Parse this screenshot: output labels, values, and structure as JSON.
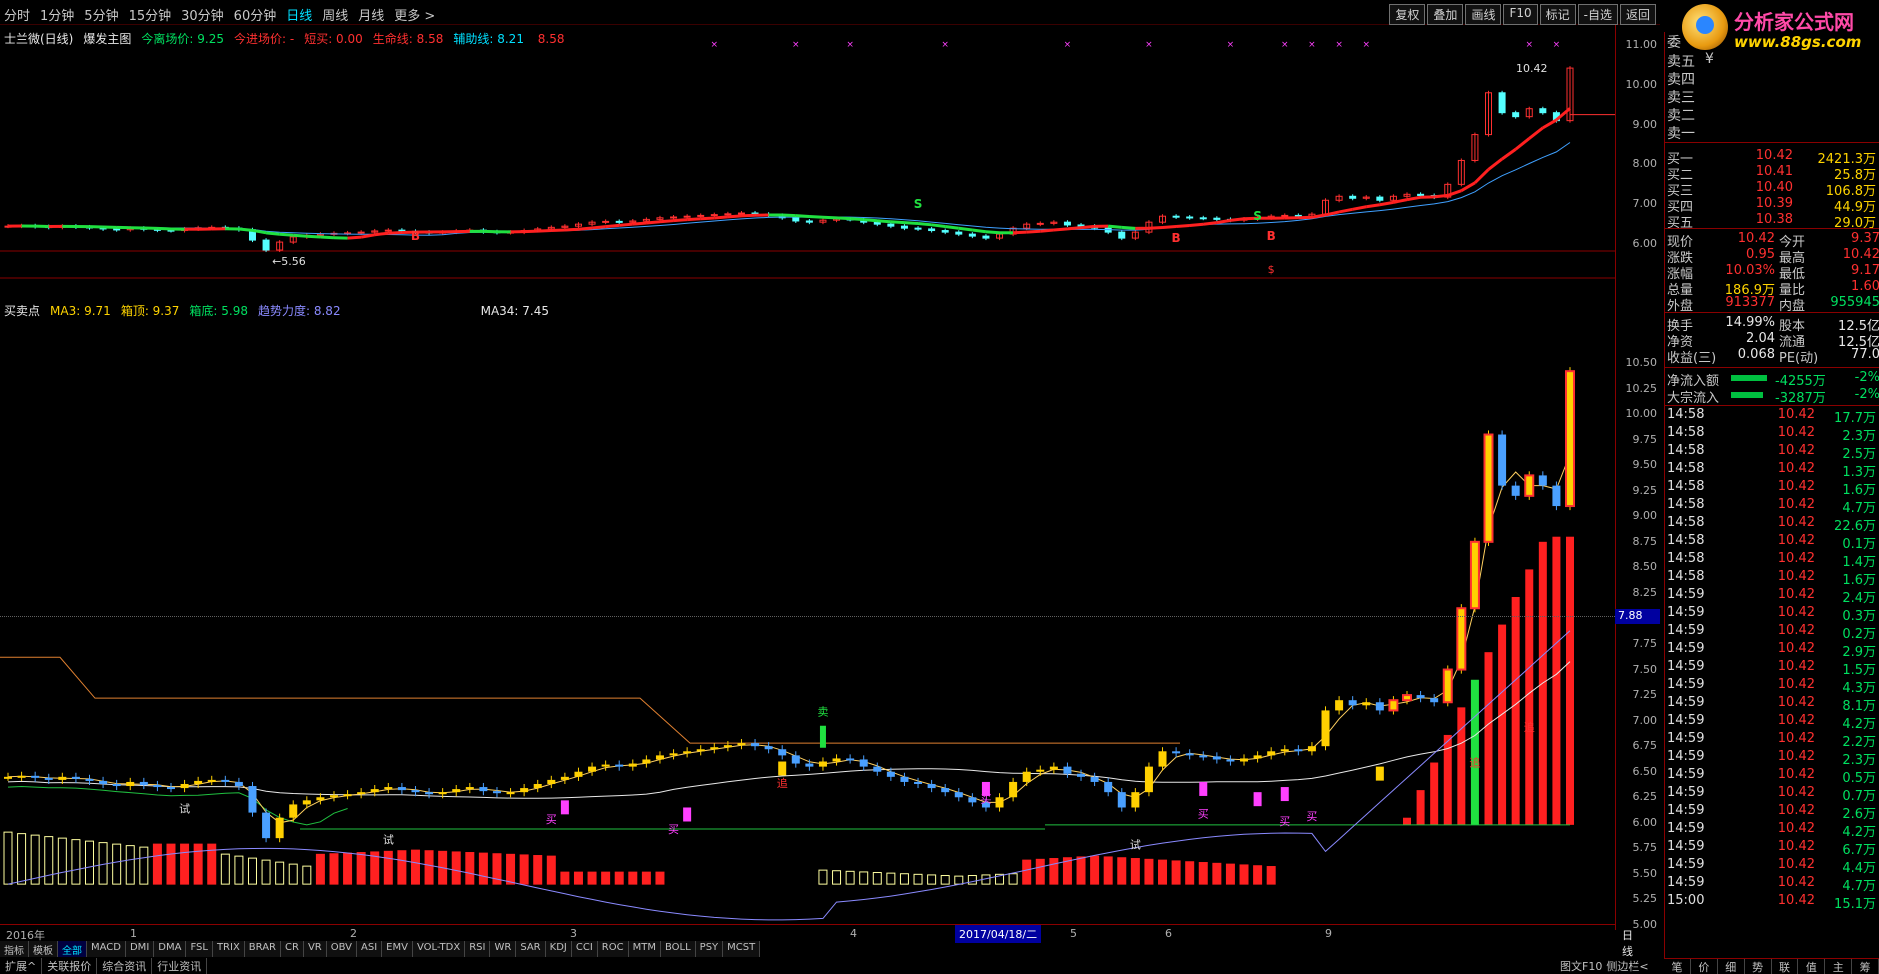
{
  "periods": [
    "分时",
    "1分钟",
    "5分钟",
    "15分钟",
    "30分钟",
    "60分钟",
    "日线",
    "周线",
    "月线",
    "更多 >"
  ],
  "active_period": "日线",
  "toolbar": [
    "复权",
    "叠加",
    "画线",
    "F10",
    "标记",
    "-自选",
    "返回"
  ],
  "logo": {
    "title": "分析家公式网",
    "url_text": "www.88gs.com"
  },
  "main_legend": {
    "stock": "士兰微(日线)",
    "formula": "爆发主图",
    "items": [
      {
        "label": "今离场价:",
        "value": "9.25",
        "color": "#00e060"
      },
      {
        "label": "今进场价:",
        "value": "-",
        "color": "#ff3030"
      },
      {
        "label": "短买:",
        "value": "0.00",
        "color": "#ff3030"
      },
      {
        "label": "生命线:",
        "value": "8.58",
        "color": "#ff3030"
      },
      {
        "label": "辅助线:",
        "value": "8.21",
        "color": "#00e0ff"
      },
      {
        "label": "",
        "value": "8.58",
        "color": "#ff3030"
      }
    ]
  },
  "sub_legend": {
    "title": "买卖点",
    "items": [
      {
        "label": "MA3:",
        "value": "9.71",
        "color": "#ffd400"
      },
      {
        "label": "箱顶:",
        "value": "9.37",
        "color": "#ffd400"
      },
      {
        "label": "箱底:",
        "value": "5.98",
        "color": "#00e060"
      },
      {
        "label": "趋势力度:",
        "value": "8.82",
        "color": "#8a8aff"
      },
      {
        "label": "MA34:",
        "value": "7.45",
        "color": "#e8e8e8"
      }
    ]
  },
  "main_axis": {
    "min": 5.6,
    "max": 11.0,
    "ticks": [
      "11.00",
      "10.00",
      "9.00",
      "8.00",
      "7.00",
      "6.00"
    ]
  },
  "sub_axis": {
    "min": 5.0,
    "max": 10.5,
    "ticks": [
      "10.50",
      "10.25",
      "10.00",
      "9.75",
      "9.50",
      "9.25",
      "9.00",
      "8.75",
      "8.50",
      "8.25",
      "8.00",
      "7.75",
      "7.50",
      "7.25",
      "7.00",
      "6.75",
      "6.50",
      "6.25",
      "6.00",
      "5.75",
      "5.50",
      "5.25",
      "5.00"
    ]
  },
  "price_marker": "7.88",
  "annotations": {
    "high": "10.42",
    "low": "5.56"
  },
  "x_labels": [
    "2016年",
    "1",
    "2",
    "3",
    "4",
    "5",
    "6",
    "9"
  ],
  "current_date": "2017/04/18/二",
  "period_label": "日线",
  "indicator_tabs": [
    "指标",
    "模板",
    "全部",
    "MACD",
    "DMI",
    "DMA",
    "FSL",
    "TRIX",
    "BRAR",
    "CR",
    "VR",
    "OBV",
    "ASI",
    "EMV",
    "VOL-TDX",
    "RSI",
    "WR",
    "SAR",
    "KDJ",
    "CCI",
    "ROC",
    "MTM",
    "BOLL",
    "PSY",
    "MCST"
  ],
  "active_indicator_tab": "全部",
  "bottom_tabs": [
    "扩展^",
    "关联报价",
    "综合资讯",
    "行业资讯"
  ],
  "bottom_right": [
    "图文F10",
    "侧边栏<"
  ],
  "side_tabs": [
    "笔",
    "价",
    "细",
    "势",
    "联",
    "值",
    "主",
    "筹"
  ],
  "orderbook": {
    "label_wei": "委",
    "asks": [
      {
        "label": "卖五",
        "price": "",
        "vol": ""
      },
      {
        "label": "卖四",
        "price": "",
        "vol": ""
      },
      {
        "label": "卖三",
        "price": "",
        "vol": ""
      },
      {
        "label": "卖二",
        "price": "",
        "vol": ""
      },
      {
        "label": "卖一",
        "price": "",
        "vol": ""
      }
    ],
    "ask_mark": "¥",
    "bids": [
      {
        "label": "买一",
        "price": "10.42",
        "vol": "2421.3万"
      },
      {
        "label": "买二",
        "price": "10.41",
        "vol": "25.8万"
      },
      {
        "label": "买三",
        "price": "10.40",
        "vol": "106.8万"
      },
      {
        "label": "买四",
        "price": "10.39",
        "vol": "44.9万"
      },
      {
        "label": "买五",
        "price": "10.38",
        "vol": "29.0万"
      }
    ]
  },
  "quote": [
    {
      "l1": "现价",
      "v1": "10.42",
      "c1": "#ff3030",
      "l2": "今开",
      "v2": "9.37",
      "c2": "#ff3030"
    },
    {
      "l1": "涨跌",
      "v1": "0.95",
      "c1": "#ff3030",
      "l2": "最高",
      "v2": "10.42",
      "c2": "#ff3030"
    },
    {
      "l1": "涨幅",
      "v1": "10.03%",
      "c1": "#ff3030",
      "l2": "最低",
      "v2": "9.17",
      "c2": "#ff3030"
    },
    {
      "l1": "总量",
      "v1": "186.9万",
      "c1": "#ffd400",
      "l2": "量比",
      "v2": "1.60",
      "c2": "#ff3030"
    },
    {
      "l1": "外盘",
      "v1": "913377",
      "c1": "#ff3030",
      "l2": "内盘",
      "v2": "955945",
      "c2": "#00e060"
    },
    {
      "l1": "换手",
      "v1": "14.99%",
      "c1": "#e8e8e8",
      "l2": "股本",
      "v2": "12.5亿",
      "c2": "#e8e8e8"
    },
    {
      "l1": "净资",
      "v1": "2.04",
      "c1": "#e8e8e8",
      "l2": "流通",
      "v2": "12.5亿",
      "c2": "#e8e8e8"
    },
    {
      "l1": "收益(三)",
      "v1": "0.068",
      "c1": "#e8e8e8",
      "l2": "PE(动)",
      "v2": "77.0",
      "c2": "#e8e8e8"
    }
  ],
  "flows": [
    {
      "label": "净流入额",
      "value": "-4255万",
      "pct": "-2%"
    },
    {
      "label": "大宗流入",
      "value": "-3287万",
      "pct": "-2%"
    }
  ],
  "ticks": [
    {
      "t": "14:58",
      "p": "10.42",
      "v": "17.7万"
    },
    {
      "t": "14:58",
      "p": "10.42",
      "v": "2.3万"
    },
    {
      "t": "14:58",
      "p": "10.42",
      "v": "2.5万"
    },
    {
      "t": "14:58",
      "p": "10.42",
      "v": "1.3万"
    },
    {
      "t": "14:58",
      "p": "10.42",
      "v": "1.6万"
    },
    {
      "t": "14:58",
      "p": "10.42",
      "v": "4.7万"
    },
    {
      "t": "14:58",
      "p": "10.42",
      "v": "22.6万"
    },
    {
      "t": "14:58",
      "p": "10.42",
      "v": "0.1万"
    },
    {
      "t": "14:58",
      "p": "10.42",
      "v": "1.4万"
    },
    {
      "t": "14:58",
      "p": "10.42",
      "v": "1.6万"
    },
    {
      "t": "14:59",
      "p": "10.42",
      "v": "2.4万"
    },
    {
      "t": "14:59",
      "p": "10.42",
      "v": "0.3万"
    },
    {
      "t": "14:59",
      "p": "10.42",
      "v": "0.2万"
    },
    {
      "t": "14:59",
      "p": "10.42",
      "v": "2.9万"
    },
    {
      "t": "14:59",
      "p": "10.42",
      "v": "1.5万"
    },
    {
      "t": "14:59",
      "p": "10.42",
      "v": "4.3万"
    },
    {
      "t": "14:59",
      "p": "10.42",
      "v": "8.1万"
    },
    {
      "t": "14:59",
      "p": "10.42",
      "v": "4.2万"
    },
    {
      "t": "14:59",
      "p": "10.42",
      "v": "2.2万"
    },
    {
      "t": "14:59",
      "p": "10.42",
      "v": "2.3万"
    },
    {
      "t": "14:59",
      "p": "10.42",
      "v": "0.5万"
    },
    {
      "t": "14:59",
      "p": "10.42",
      "v": "0.7万"
    },
    {
      "t": "14:59",
      "p": "10.42",
      "v": "2.6万"
    },
    {
      "t": "14:59",
      "p": "10.42",
      "v": "4.2万"
    },
    {
      "t": "14:59",
      "p": "10.42",
      "v": "6.7万"
    },
    {
      "t": "14:59",
      "p": "10.42",
      "v": "4.4万"
    },
    {
      "t": "14:59",
      "p": "10.42",
      "v": "4.7万"
    },
    {
      "t": "15:00",
      "p": "10.42",
      "v": "15.1万"
    }
  ],
  "chart_data": {
    "type": "candlestick",
    "closes": [
      6.45,
      6.46,
      6.44,
      6.42,
      6.45,
      6.43,
      6.41,
      6.38,
      6.36,
      6.4,
      6.37,
      6.35,
      6.34,
      6.38,
      6.41,
      6.42,
      6.4,
      6.36,
      6.1,
      5.85,
      6.05,
      6.18,
      6.22,
      6.25,
      6.27,
      6.28,
      6.3,
      6.33,
      6.35,
      6.32,
      6.3,
      6.28,
      6.3,
      6.33,
      6.35,
      6.31,
      6.29,
      6.3,
      6.34,
      6.38,
      6.42,
      6.45,
      6.5,
      6.55,
      6.57,
      6.55,
      6.58,
      6.62,
      6.66,
      6.68,
      6.7,
      6.72,
      6.74,
      6.76,
      6.78,
      6.75,
      6.72,
      6.66,
      6.58,
      6.55,
      6.6,
      6.63,
      6.62,
      6.55,
      6.5,
      6.45,
      6.4,
      6.38,
      6.34,
      6.3,
      6.25,
      6.2,
      6.15,
      6.25,
      6.4,
      6.5,
      6.52,
      6.55,
      6.48,
      6.45,
      6.4,
      6.3,
      6.15,
      6.3,
      6.55,
      6.7,
      6.68,
      6.66,
      6.65,
      6.62,
      6.6,
      6.63,
      6.66,
      6.7,
      6.72,
      6.7,
      6.75,
      7.1,
      7.2,
      7.15,
      7.18,
      7.1,
      7.2,
      7.25,
      7.22,
      7.18,
      7.5,
      8.1,
      8.75,
      9.8,
      9.3,
      9.2,
      9.4,
      9.3,
      9.1,
      10.42
    ],
    "markers_main": [
      "B",
      "S",
      "B",
      "S",
      "B",
      "S"
    ],
    "markers_sub": [
      "卖",
      "买",
      "试",
      "追",
      "卖"
    ]
  }
}
